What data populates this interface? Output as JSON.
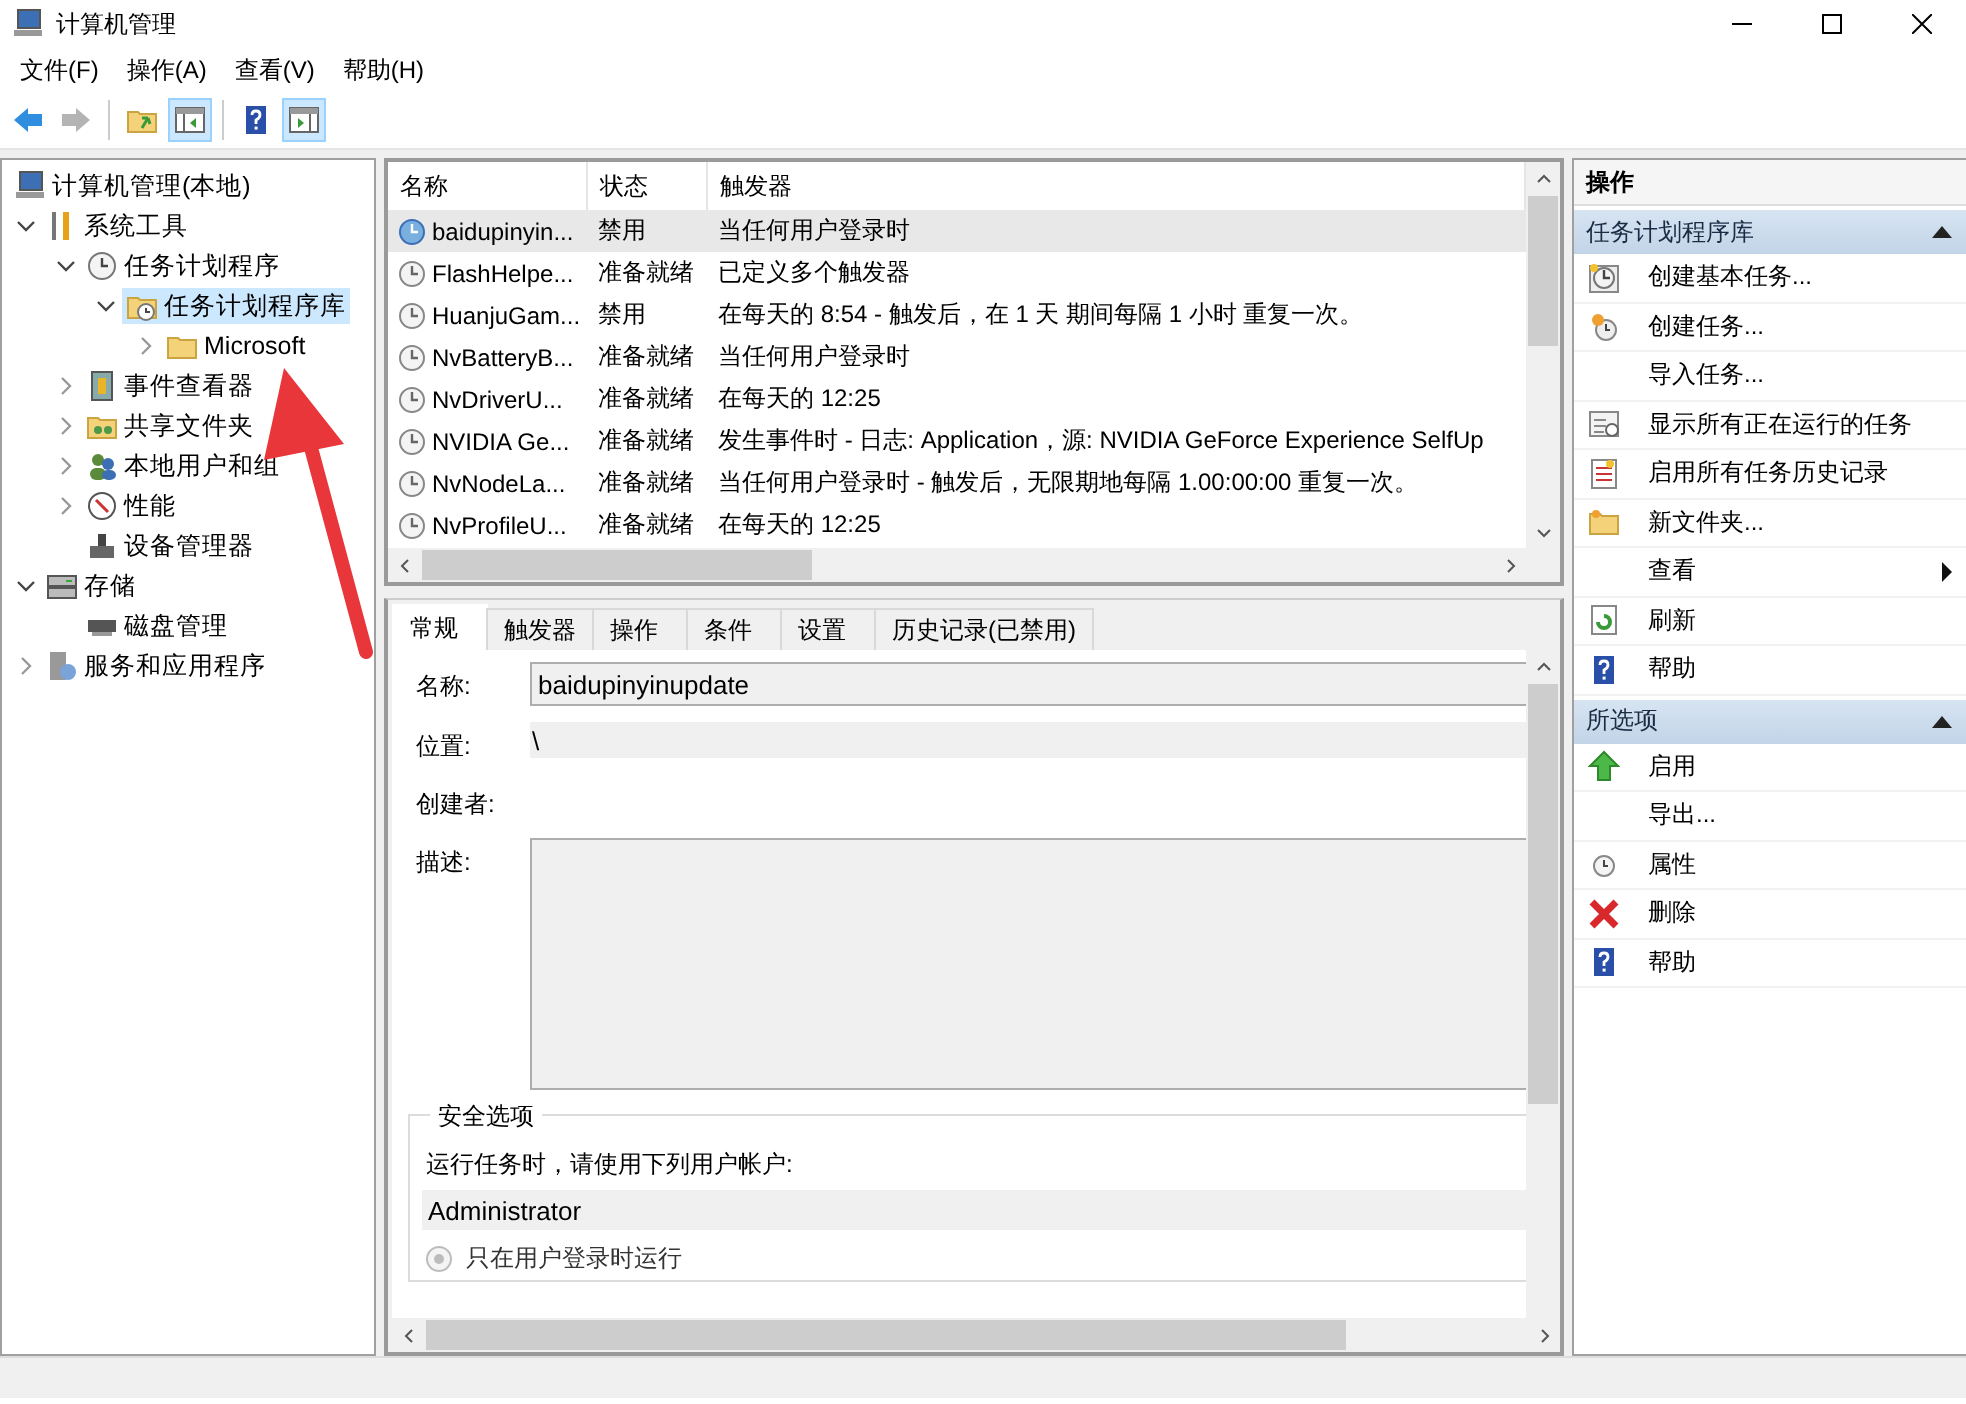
{
  "window": {
    "title": "计算机管理"
  },
  "menu": [
    "文件(F)",
    "操作(A)",
    "查看(V)",
    "帮助(H)"
  ],
  "toolbar": [
    {
      "kind": "back",
      "on": false,
      "disabled": false
    },
    {
      "kind": "forward",
      "on": false,
      "disabled": true
    },
    {
      "kind": "up",
      "on": false,
      "disabled": false
    },
    {
      "kind": "tree",
      "on": true,
      "disabled": false
    },
    {
      "kind": "help",
      "on": false,
      "disabled": false
    },
    {
      "kind": "pane",
      "on": true,
      "disabled": false
    }
  ],
  "tree": [
    {
      "label": "计算机管理(本地)",
      "kind": "computer",
      "selected": false,
      "children": [
        {
          "label": "系统工具",
          "kind": "tools",
          "expanded": true,
          "selected": false,
          "children": [
            {
              "label": "任务计划程序",
              "kind": "clock",
              "expanded": true,
              "selected": false,
              "children": [
                {
                  "label": "任务计划程序库",
                  "kind": "clockfolder",
                  "expanded": true,
                  "selected": true,
                  "children": [
                    {
                      "label": "Microsoft",
                      "kind": "folder",
                      "expanded": false,
                      "selected": false
                    }
                  ]
                }
              ]
            },
            {
              "label": "事件查看器",
              "kind": "event",
              "expanded": false,
              "selected": false
            },
            {
              "label": "共享文件夹",
              "kind": "share",
              "expanded": false,
              "selected": false
            },
            {
              "label": "本地用户和组",
              "kind": "users",
              "expanded": false,
              "selected": false
            },
            {
              "label": "性能",
              "kind": "perf",
              "expanded": false,
              "selected": false
            },
            {
              "label": "设备管理器",
              "kind": "device",
              "selected": false
            }
          ]
        },
        {
          "label": "存储",
          "kind": "storage",
          "expanded": true,
          "selected": false,
          "children": [
            {
              "label": "磁盘管理",
              "kind": "disk",
              "selected": false
            }
          ]
        },
        {
          "label": "服务和应用程序",
          "kind": "services",
          "expanded": false,
          "selected": false
        }
      ]
    }
  ],
  "list": {
    "columns": [
      "名称",
      "状态",
      "触发器"
    ],
    "rows": [
      {
        "name": "baidupinyin...",
        "status": "禁用",
        "trigger": "当任何用户登录时",
        "selected": true
      },
      {
        "name": "FlashHelpe...",
        "status": "准备就绪",
        "trigger": "已定义多个触发器",
        "selected": false
      },
      {
        "name": "HuanjuGam...",
        "status": "禁用",
        "trigger": "在每天的 8:54 - 触发后，在 1 天 期间每隔 1 小时 重复一次。",
        "selected": false
      },
      {
        "name": "NvBatteryB...",
        "status": "准备就绪",
        "trigger": "当任何用户登录时",
        "selected": false
      },
      {
        "name": "NvDriverU...",
        "status": "准备就绪",
        "trigger": "在每天的 12:25",
        "selected": false
      },
      {
        "name": "NVIDIA Ge...",
        "status": "准备就绪",
        "trigger": "发生事件时 - 日志: Application，源: NVIDIA GeForce Experience SelfUp",
        "selected": false
      },
      {
        "name": "NvNodeLa...",
        "status": "准备就绪",
        "trigger": "当任何用户登录时 - 触发后，无限期地每隔 1.00:00:00 重复一次。",
        "selected": false
      },
      {
        "name": "NvProfileU...",
        "status": "准备就绪",
        "trigger": "在每天的 12:25",
        "selected": false
      }
    ]
  },
  "detail": {
    "tabs": [
      {
        "label": "常规",
        "selected": true
      },
      {
        "label": "触发器",
        "selected": false
      },
      {
        "label": "操作",
        "selected": false
      },
      {
        "label": "条件",
        "selected": false
      },
      {
        "label": "设置",
        "selected": false
      },
      {
        "label": "历史记录(已禁用)",
        "selected": false
      }
    ],
    "fields": [
      {
        "kind": "input",
        "label": "名称:",
        "value": "baidupinyinupdate"
      },
      {
        "kind": "readonly",
        "label": "位置:",
        "value": "\\"
      },
      {
        "kind": "plain",
        "label": "创建者:"
      },
      {
        "kind": "textarea",
        "label": "描述:"
      }
    ],
    "security": {
      "title": "安全选项",
      "prompt": "运行任务时，请使用下列用户帐户:",
      "account": "Administrator",
      "options": [
        {
          "label": "只在用户登录时运行",
          "selected": true,
          "disabled": true
        }
      ]
    }
  },
  "actions": {
    "title": "操作",
    "sections": [
      {
        "title": "任务计划程序库",
        "expanded": true,
        "items": [
          {
            "label": "创建基本任务...",
            "kind": "basic"
          },
          {
            "label": "创建任务...",
            "kind": "task"
          },
          {
            "label": "导入任务...",
            "kind": "none"
          },
          {
            "label": "显示所有正在运行的任务",
            "kind": "running"
          },
          {
            "label": "启用所有任务历史记录",
            "kind": "history"
          },
          {
            "label": "新文件夹...",
            "kind": "newfolder"
          },
          {
            "label": "查看",
            "kind": "none",
            "submenu": true
          },
          {
            "label": "刷新",
            "kind": "refresh"
          },
          {
            "label": "帮助",
            "kind": "help"
          }
        ]
      },
      {
        "title": "所选项",
        "expanded": true,
        "items": [
          {
            "label": "启用",
            "kind": "enable"
          },
          {
            "label": "导出...",
            "kind": "none"
          },
          {
            "label": "属性",
            "kind": "props"
          },
          {
            "label": "删除",
            "kind": "delete"
          },
          {
            "label": "帮助",
            "kind": "help"
          }
        ]
      }
    ]
  }
}
